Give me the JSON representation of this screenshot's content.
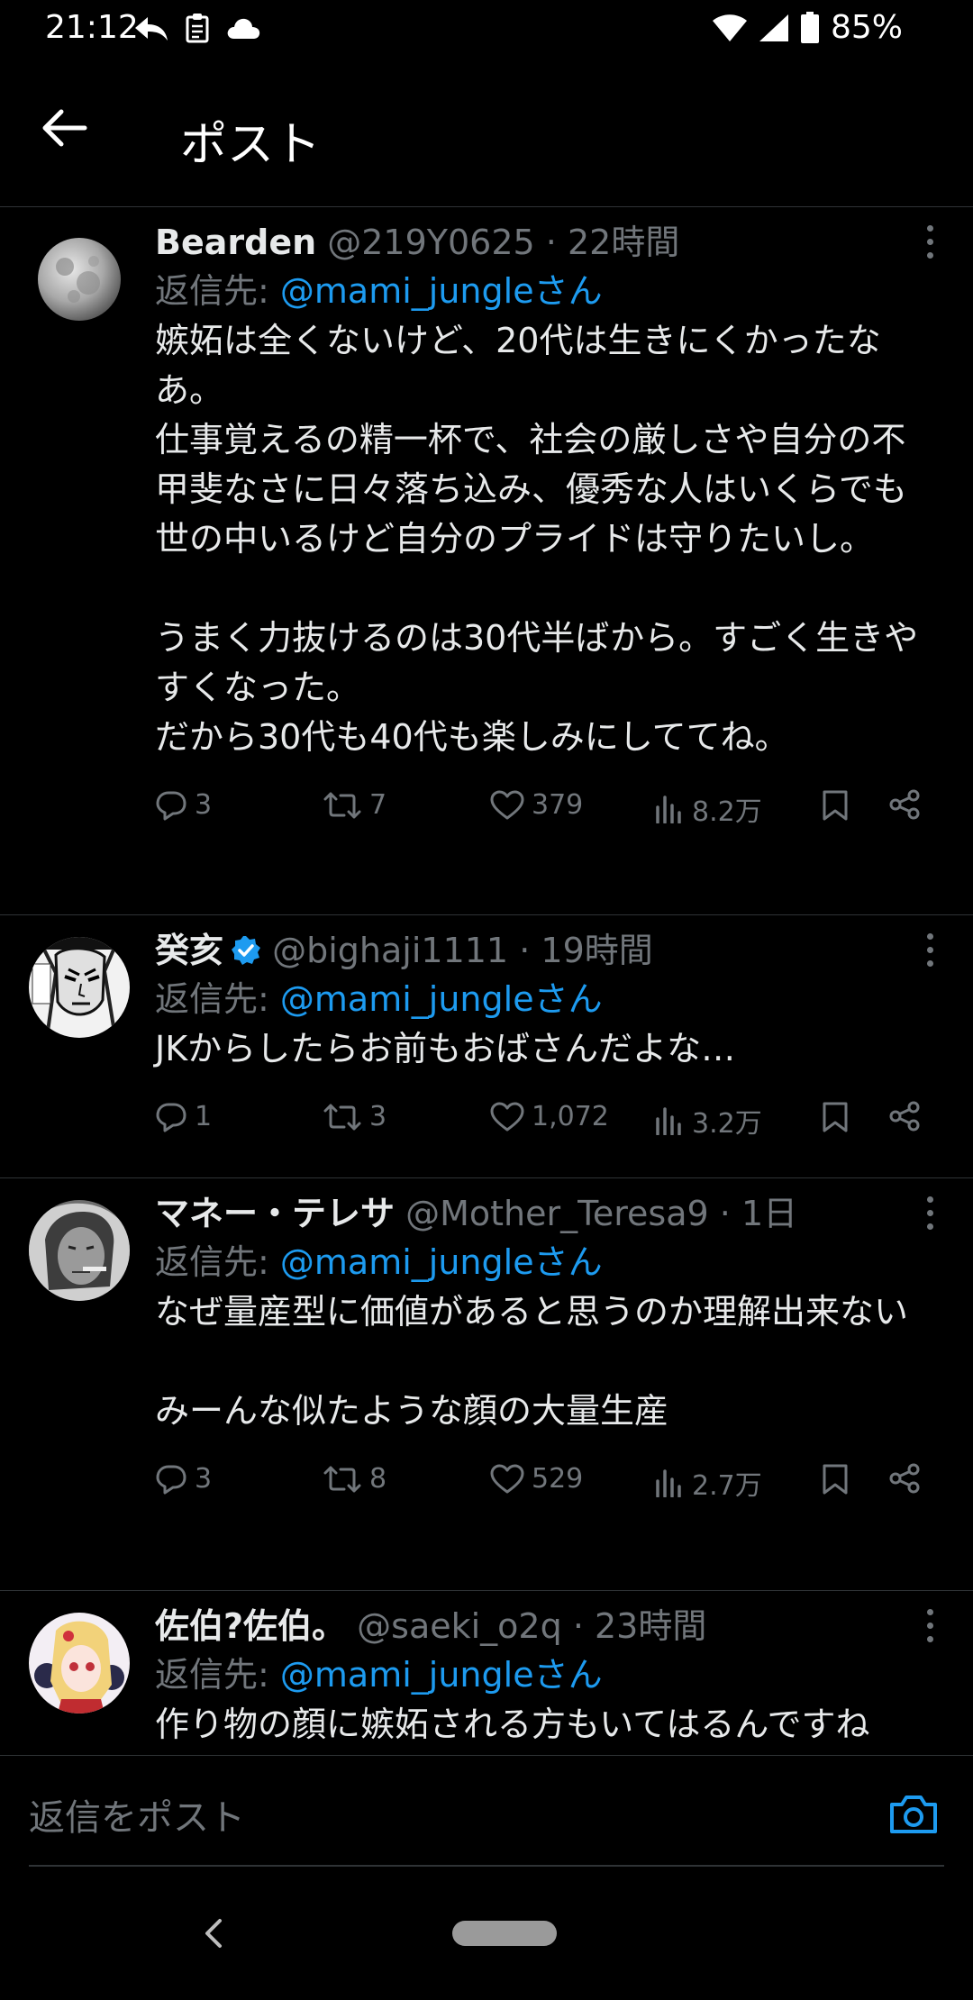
{
  "status_bar": {
    "time": "21:12",
    "battery": "85%"
  },
  "header": {
    "title": "ポスト"
  },
  "reply_prefix": "返信先:",
  "posts": [
    {
      "name": "Bearden",
      "handle": "@219Y0625",
      "time": "22時間",
      "reply_to": "@mami_jungleさん",
      "text": "嫉妬は全くないけど、20代は生きにくかったなあ。\n仕事覚えるの精一杯で、社会の厳しさや自分の不甲斐なさに日々落ち込み、優秀な人はいくらでも世の中いるけど自分のプライドは守りたいし。\n\nうまく力抜けるのは30代半ばから。すごく生きやすくなった。\nだから30代も40代も楽しみにしててね。",
      "replies": "3",
      "reposts": "7",
      "likes": "379",
      "views": "8.2万"
    },
    {
      "name": "癸亥",
      "handle": "@bighaji1111",
      "time": "19時間",
      "reply_to": "@mami_jungleさん",
      "text": "JKからしたらお前もおばさんだよな…",
      "replies": "1",
      "reposts": "3",
      "likes": "1,072",
      "views": "3.2万"
    },
    {
      "name": "マネー・テレサ",
      "handle": "@Mother_Teresa9",
      "time": "1日",
      "reply_to": "@mami_jungleさん",
      "text": "なぜ量産型に価値があると思うのか理解出来ない\n\nみーんな似たような顔の大量生産",
      "replies": "3",
      "reposts": "8",
      "likes": "529",
      "views": "2.7万"
    },
    {
      "name": "佐伯?佐伯。",
      "handle": "@saeki_o2q",
      "time": "23時間",
      "reply_to": "@mami_jungleさん",
      "text": "作り物の顔に嫉妬される方もいてはるんですね"
    }
  ],
  "compose": {
    "placeholder": "返信をポスト"
  },
  "colors": {
    "accent": "#1d9bf0",
    "muted": "#71767b",
    "background": "#000000"
  }
}
